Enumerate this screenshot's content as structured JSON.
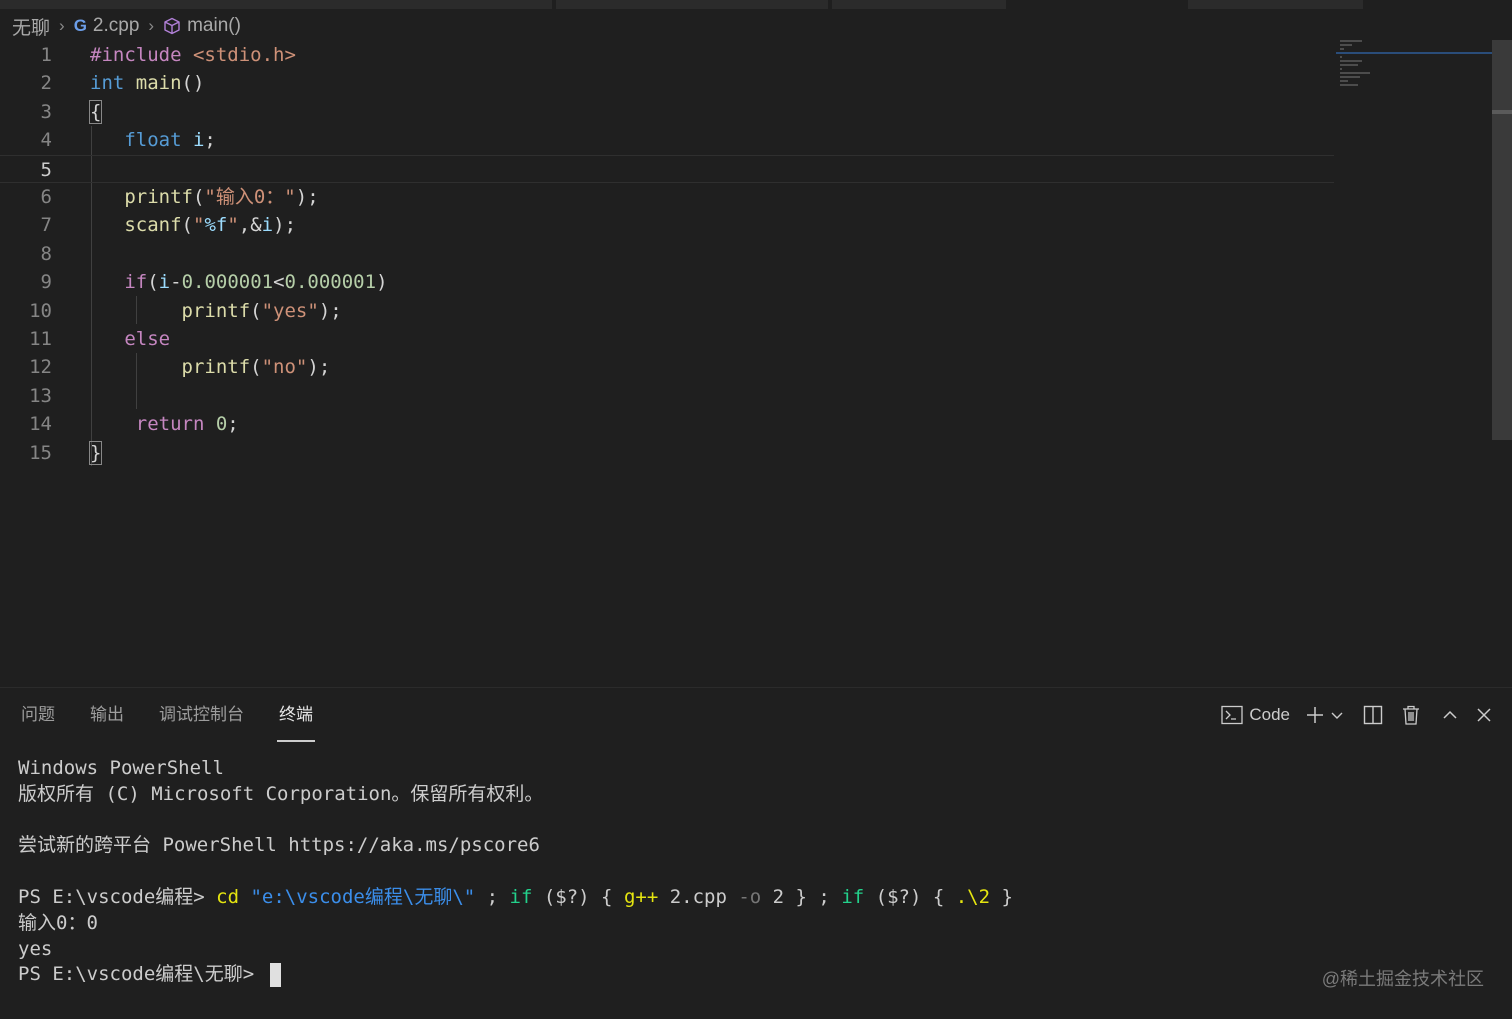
{
  "breadcrumb": {
    "folder": "无聊",
    "file": "2.cpp",
    "symbol": "main()"
  },
  "editor": {
    "current_line": 5,
    "lines": [
      {
        "n": "1"
      },
      {
        "n": "2"
      },
      {
        "n": "3"
      },
      {
        "n": "4"
      },
      {
        "n": "5"
      },
      {
        "n": "6"
      },
      {
        "n": "7"
      },
      {
        "n": "8"
      },
      {
        "n": "9"
      },
      {
        "n": "10"
      },
      {
        "n": "11"
      },
      {
        "n": "12"
      },
      {
        "n": "13"
      },
      {
        "n": "14"
      },
      {
        "n": "15"
      }
    ],
    "tokens": {
      "l1_a": "#include",
      "l1_b": " <stdio.h>",
      "l2_a": "int",
      "l2_b": " main",
      "l2_c": "()",
      "l3_a": "{",
      "l4_a": "float",
      "l4_b": " i",
      "l4_c": ";",
      "l6_a": "printf",
      "l6_b": "(",
      "l6_c": "\"输入0：\"",
      "l6_d": ");",
      "l7_a": "scanf",
      "l7_b": "(",
      "l7_c": "\"",
      "l7_d": "%f",
      "l7_e": "\"",
      "l7_f": ",&",
      "l7_g": "i",
      "l7_h": ");",
      "l9_a": "if",
      "l9_b": "(",
      "l9_c": "i",
      "l9_d": "-",
      "l9_e": "0.000001",
      "l9_f": "<",
      "l9_g": "0.000001",
      "l9_h": ")",
      "l10_a": "printf",
      "l10_b": "(",
      "l10_c": "\"yes\"",
      "l10_d": ");",
      "l11_a": "else",
      "l12_a": "printf",
      "l12_b": "(",
      "l12_c": "\"no\"",
      "l12_d": ");",
      "l14_a": "return",
      "l14_b": " 0",
      "l14_c": ";",
      "l15_a": "}"
    }
  },
  "panel": {
    "tabs": [
      "问题",
      "输出",
      "调试控制台",
      "终端"
    ],
    "active_tab": "终端",
    "terminal_profile": "Code"
  },
  "terminal": {
    "l1": "Windows PowerShell",
    "l2": "版权所有 (C) Microsoft Corporation。保留所有权利。",
    "l3": "尝试新的跨平台 PowerShell https://aka.ms/pscore6",
    "cmd_prompt": "PS E:\\vscode编程> ",
    "cmd_cd": "cd",
    "cmd_path": " \"e:\\vscode编程\\无聊\\\"",
    "cmd_semi1": " ; ",
    "cmd_if1": "if",
    "cmd_cond1": " ($?) { ",
    "cmd_gpp": "g++",
    "cmd_file": " 2.cpp ",
    "cmd_flag": "-o",
    "cmd_out": " 2 } ; ",
    "cmd_if2": "if",
    "cmd_cond2": " ($?) { ",
    "cmd_run": ".\\2",
    "cmd_end": " }",
    "l5": "输入0：0",
    "l6": "yes",
    "prompt2": "PS E:\\vscode编程\\无聊> "
  },
  "watermark": "@稀土掘金技术社区",
  "colors": {
    "background": "#1f1f1f",
    "keyword": "#569cd6",
    "control": "#c586c0",
    "string": "#ce9178",
    "function": "#dcdcaa",
    "variable": "#9cdcfe",
    "number": "#b5cea8"
  }
}
